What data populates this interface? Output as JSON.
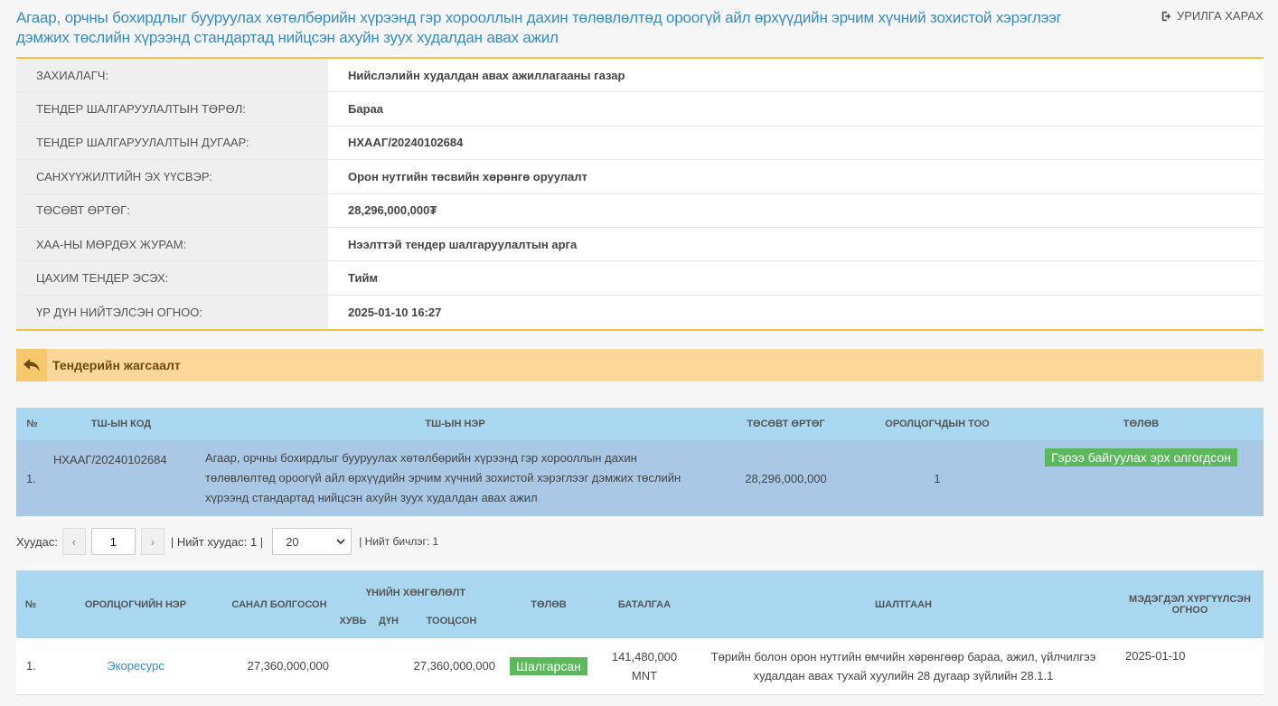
{
  "page": {
    "title": "Агаар, орчны бохирдлыг бууруулах хөтөлбөрийн хүрээнд гэр хорооллын дахин төлөвлөлтөд ороогүй айл өрхүүдийн эрчим хүчний зохистой хэрэглээг дэмжих төслийн хүрээнд стандартад нийцсэн ахуйн зуух худалдан авах ажил",
    "invite_label": "УРИЛГА ХАРАХ"
  },
  "info": [
    {
      "label": "Захиалагч:",
      "value": "Нийслэлийн худалдан авах ажиллагааны газар"
    },
    {
      "label": "Тендер шалгаруулалтын төрөл:",
      "value": "Бараа"
    },
    {
      "label": "Тендер шалгаруулалтын дугаар:",
      "value": "НХААГ/20240102684"
    },
    {
      "label": "Санхүүжилтийн эх үүсвэр:",
      "value": "Орон нутгийн төсвийн хөрөнгө оруулалт"
    },
    {
      "label": "Төсөвт өртөг:",
      "value": "28,296,000,000₮"
    },
    {
      "label": "ХАА-ны мөрдөх журам:",
      "value": "Нээлттэй тендер шалгаруулалтын арга"
    },
    {
      "label": "Цахим тендер эсэх:",
      "value": "Тийм"
    },
    {
      "label": "ҮР ДҮН НИЙТЭЛСЭН ОГНОО:",
      "value": "2025-01-10 16:27"
    }
  ],
  "summary": {
    "label": "Тендерийн жагсаалт"
  },
  "tender_table": {
    "headers": [
      "№",
      "ТШ-ын код",
      "ТШ-ын нэр",
      "Төсөвт өртөг",
      "Оролцогчдын тоо",
      "Төлөв"
    ],
    "rows": [
      {
        "num": "1.",
        "code": "НХААГ/20240102684",
        "name": "Агаар, орчны бохирдлыг бууруулах хөтөлбөрийн хүрээнд гэр хорооллын дахин төлөвлөлтөд ороогүй айл өрхүүдийн эрчим хүчний зохистой хэрэглээг дэмжих төслийн хүрээнд стандартад нийцсэн ахуйн зуух худалдан авах ажил",
        "budget": "28,296,000,000",
        "participants": "1",
        "status": "Гэрээ байгуулах эрх олгогдсон"
      }
    ]
  },
  "pager": {
    "page_label": "Хуудас:",
    "prev": "‹",
    "page_value": "1",
    "next": "›",
    "total_pages": "| Нийт хуудас: 1 |",
    "page_size": "20",
    "total_records": "| Нийт бичлэг: 1"
  },
  "bid_table": {
    "headers": {
      "num": "№",
      "bidder": "Оролцогчийн нэр",
      "offer": "Санал болгосон",
      "discount_group": "Үнийн хөнгөлөлт",
      "discount_pct": "Хувь",
      "discount_amount": "Дүн",
      "calculated": "Тооцсон",
      "status": "Төлөв",
      "guarantee": "Баталгаа",
      "reason": "Шалтгаан",
      "notice_date": "Мэдэгдэл хүргүүлсэн огноо"
    },
    "rows": [
      {
        "num": "1.",
        "bidder": "Экоресурс",
        "offer": "27,360,000,000",
        "discount_pct": "",
        "discount_amount": "",
        "calculated": "27,360,000,000",
        "status": "Шалгарсан",
        "guarantee": "141,480,000 MNT",
        "reason": "Төрийн болон орон нутгийн өмчийн хөрөнгөөр бараа, ажил, үйлчилгээ худалдан авах тухай хуулийн 28 дугаар зүйлийн 28.1.1",
        "notice_date": "2025-01-10"
      }
    ]
  },
  "colors": {
    "accent": "#3a8bbd",
    "header_bg": "#a9d7f0",
    "row_highlight": "#a8c8e5",
    "summary_bg": "#fbd899",
    "success": "#5cb85c",
    "border_gold": "#f0c040"
  }
}
